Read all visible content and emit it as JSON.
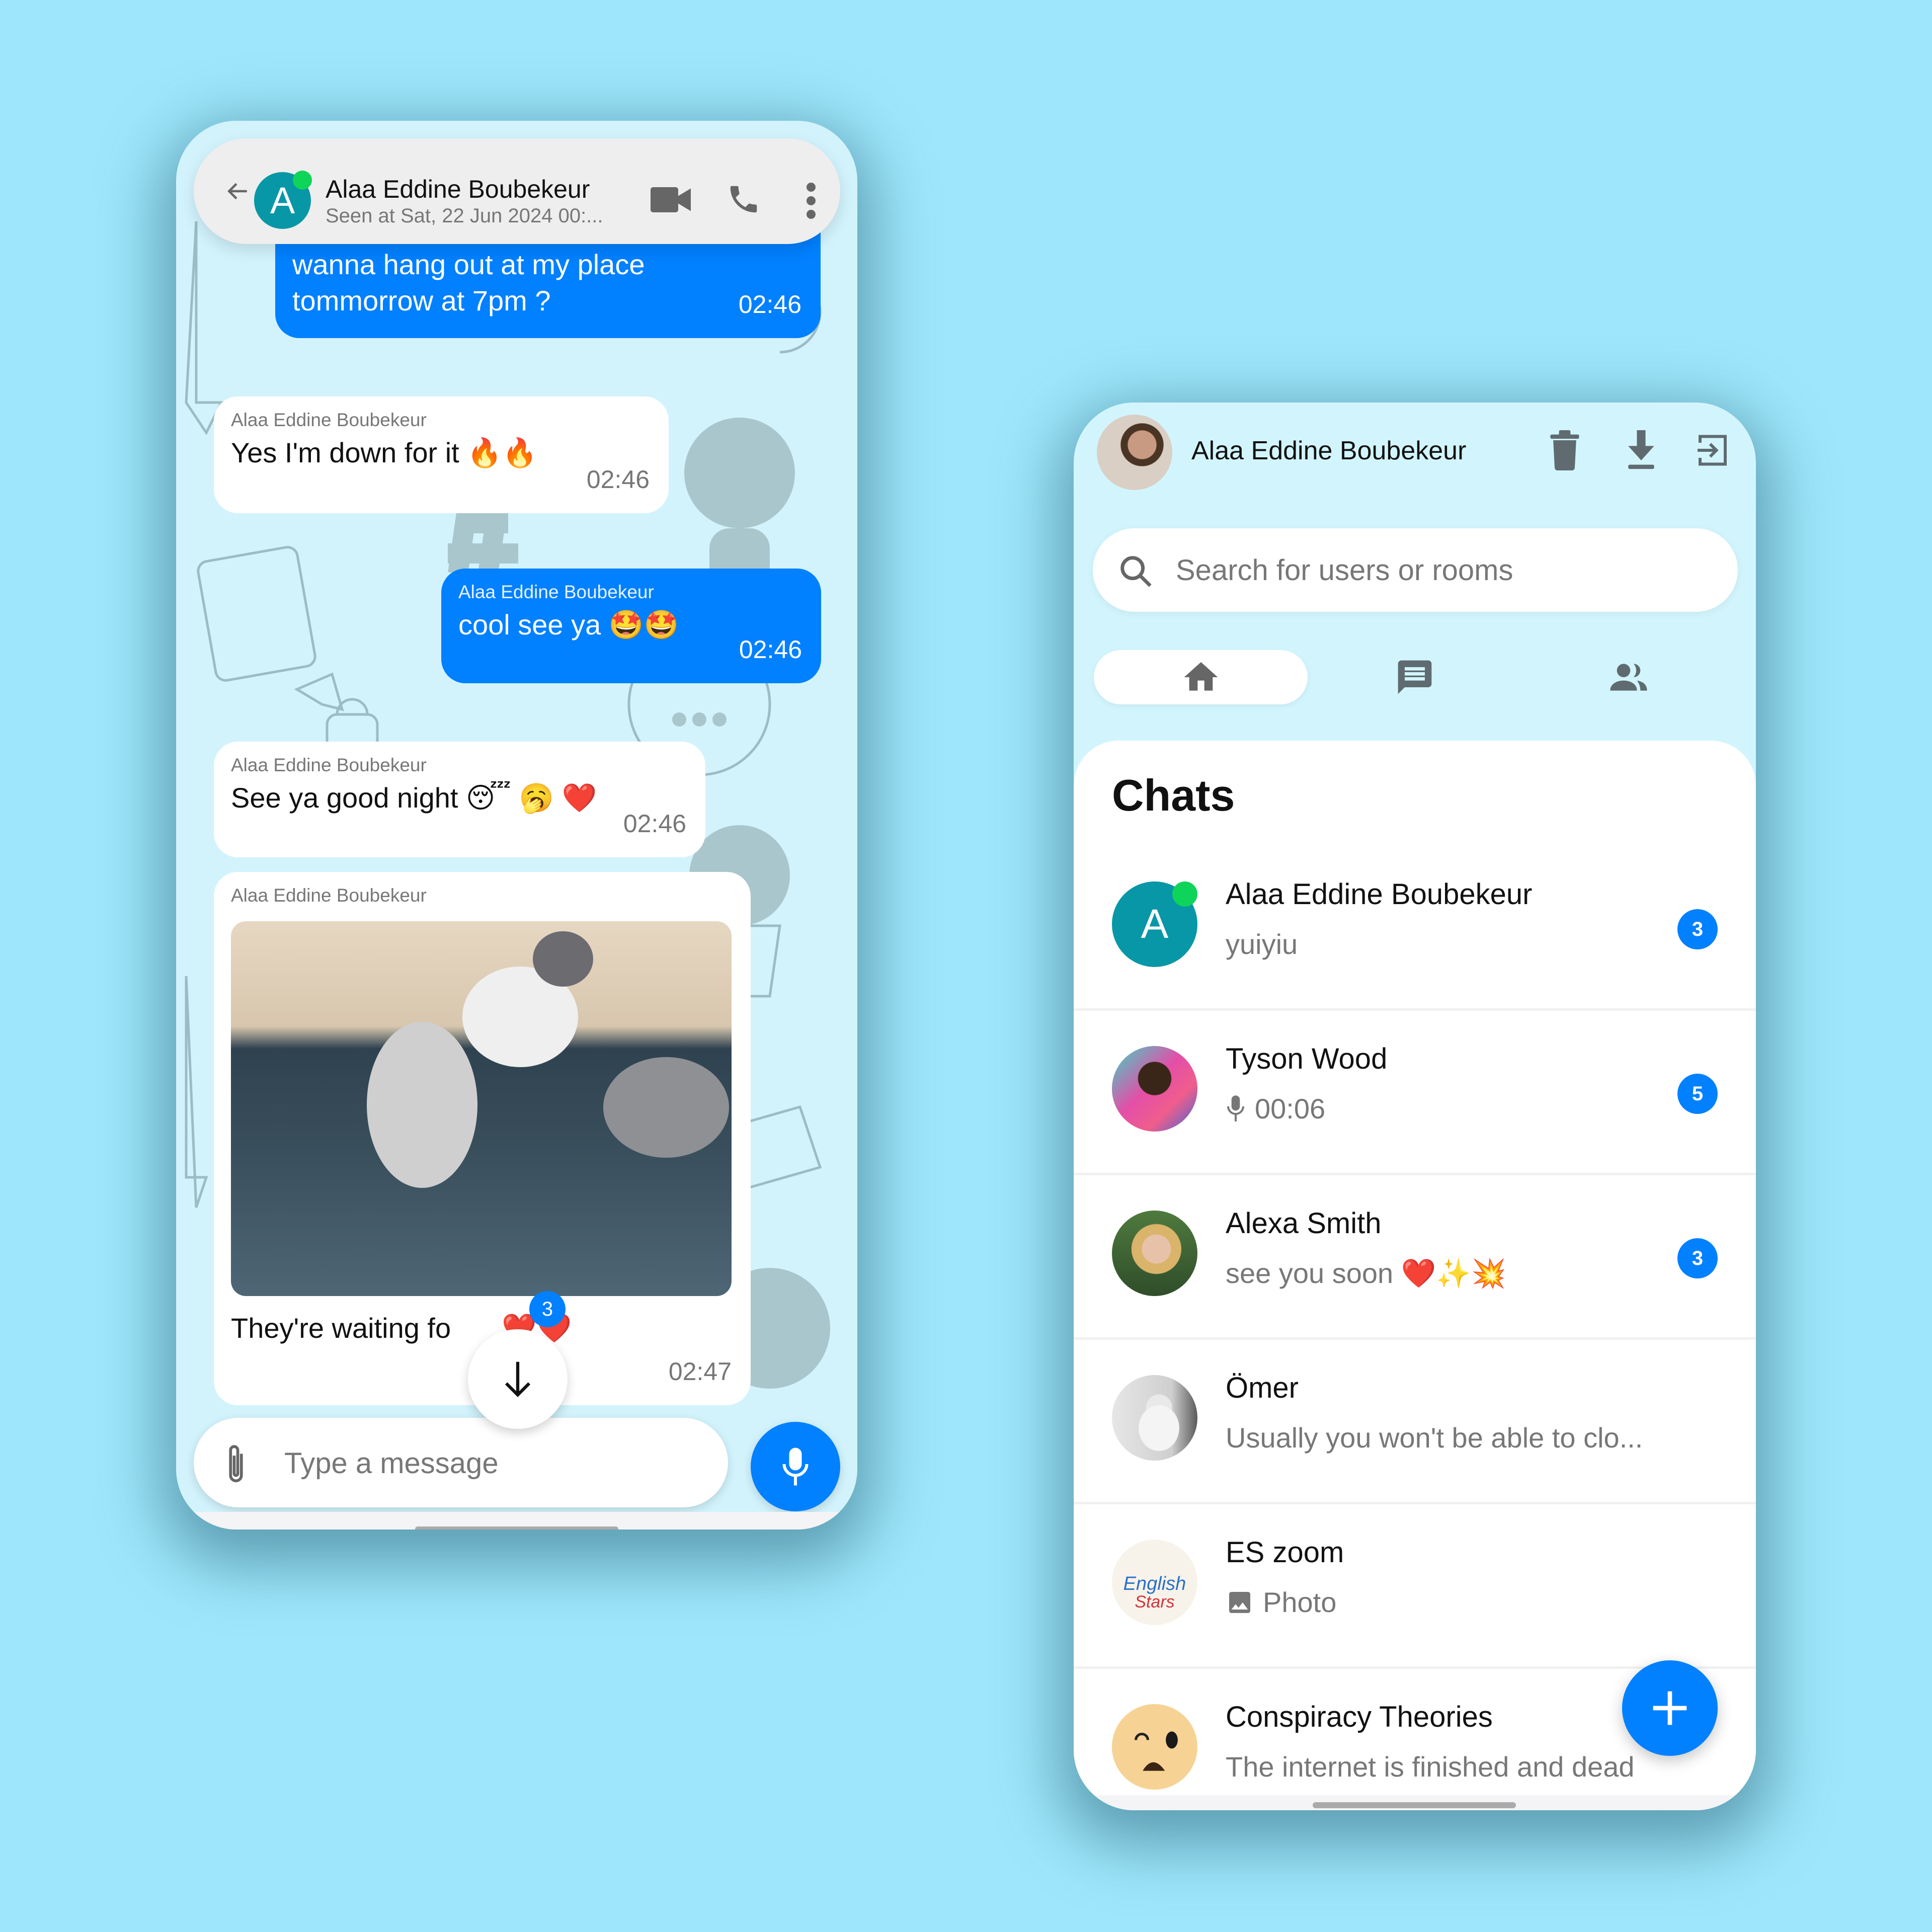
{
  "left_phone": {
    "header": {
      "back_icon": "arrow-left-icon",
      "avatar_letter": "A",
      "online": true,
      "name": "Alaa Eddine Boubekeur",
      "status": "Seen at Sat, 22 Jun 2024 00:...",
      "actions": [
        "video-call-icon",
        "phone-icon",
        "more-vertical-icon"
      ]
    },
    "messages": [
      {
        "direction": "out",
        "sender": "",
        "text": "wanna hang out at my place tommorrow at 7pm ?",
        "time": "02:46"
      },
      {
        "direction": "in",
        "sender": "Alaa Eddine Boubekeur",
        "text": "Yes I'm down for it 🔥🔥",
        "time": "02:46"
      },
      {
        "direction": "out",
        "sender": "Alaa Eddine Boubekeur",
        "text": "cool see ya 🤩🤩",
        "time": "02:46"
      },
      {
        "direction": "in",
        "sender": "Alaa Eddine Boubekeur",
        "text": "See ya good night 😴 🥱 ❤️",
        "time": "02:46"
      },
      {
        "direction": "in",
        "sender": "Alaa Eddine Boubekeur",
        "attachment": "photo-of-kittens-on-couch",
        "text": "They're waiting fo         ❤️❤️",
        "time": "02:47"
      }
    ],
    "scroll_down": {
      "icon": "arrow-down-icon",
      "badge": "3"
    },
    "composer": {
      "attach_icon": "paperclip-icon",
      "placeholder": "Type a message",
      "value": "",
      "send_icon": "microphone-icon"
    }
  },
  "right_phone": {
    "header": {
      "user_name": "Alaa Eddine Boubekeur",
      "actions": [
        "trash-icon",
        "download-icon",
        "logout-icon"
      ]
    },
    "search": {
      "placeholder": "Search for users or rooms",
      "value": ""
    },
    "tabs": [
      {
        "name": "home",
        "icon": "home-icon",
        "active": true
      },
      {
        "name": "chats",
        "icon": "chat-icon",
        "active": false
      },
      {
        "name": "contacts",
        "icon": "people-icon",
        "active": false
      }
    ],
    "section_title": "Chats",
    "chats": [
      {
        "name": "Alaa Eddine Boubekeur",
        "avatar_letter": "A",
        "online": true,
        "preview": "yuiyiu",
        "preview_icon": "",
        "unread": "3"
      },
      {
        "name": "Tyson Wood",
        "avatar_letter": "",
        "online": false,
        "preview": "00:06",
        "preview_icon": "microphone-icon",
        "unread": "5"
      },
      {
        "name": "Alexa Smith",
        "avatar_letter": "",
        "online": false,
        "preview": "see you soon ❤️✨💥",
        "preview_icon": "",
        "unread": "3"
      },
      {
        "name": "Ömer",
        "avatar_letter": "",
        "online": false,
        "preview": "Usually you won't be able to clo...",
        "preview_icon": "",
        "unread": ""
      },
      {
        "name": "ES zoom",
        "avatar_letter": "",
        "avatar_text": [
          "English",
          "Stars"
        ],
        "online": false,
        "preview": "Photo",
        "preview_icon": "image-icon",
        "unread": ""
      },
      {
        "name": "Conspiracy Theories",
        "avatar_letter": "",
        "online": false,
        "preview": "The internet is finished and dead",
        "preview_icon": "",
        "unread": ""
      }
    ],
    "fab": {
      "icon": "plus-icon"
    }
  },
  "colors": {
    "page_background": "#9ee6fb",
    "phone_background": "#d2f3fc",
    "accent_blue": "#0180ff",
    "avatar_teal": "#0897a6",
    "online_green": "#0fd45a",
    "icon_gray": "#5f6b70",
    "muted_text": "#777777"
  }
}
